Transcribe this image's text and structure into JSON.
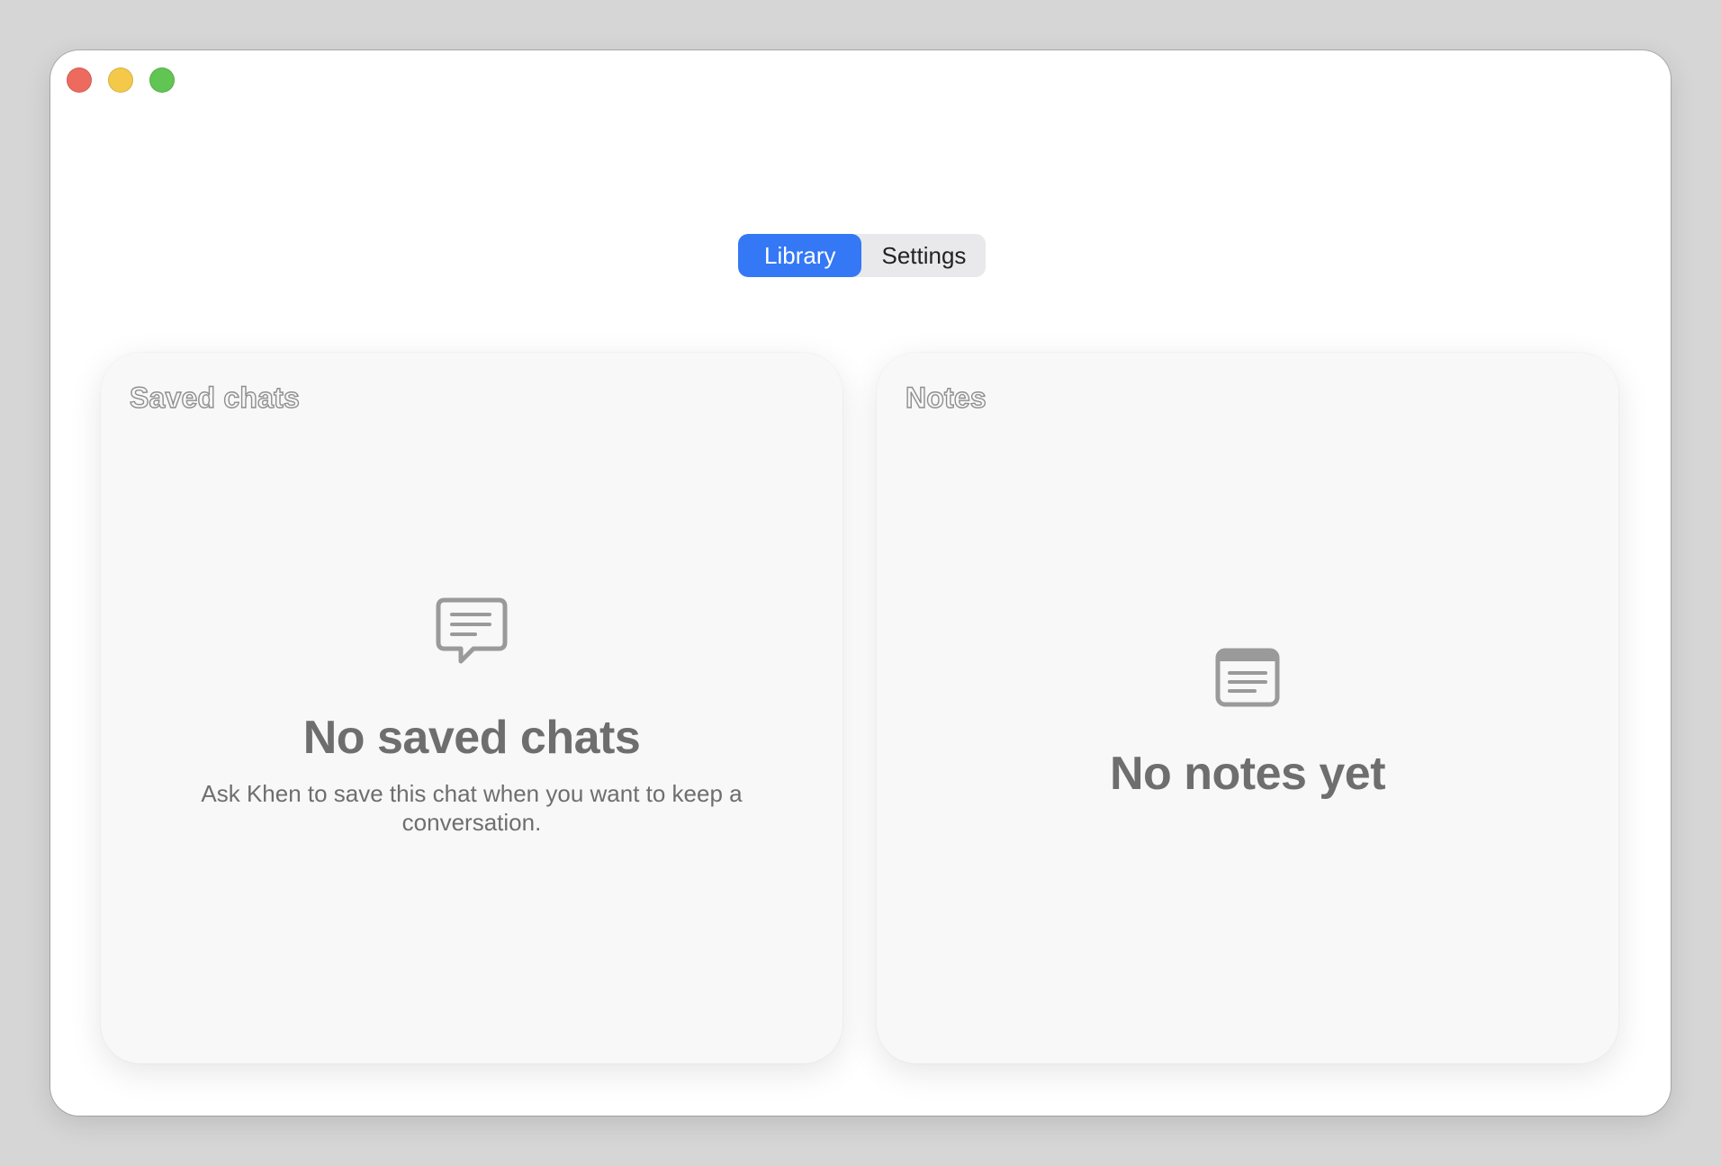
{
  "window": {
    "controls": {
      "close_color": "#ed6a5e",
      "minimize_color": "#f4c94a",
      "zoom_color": "#61c554"
    }
  },
  "tabs": [
    {
      "label": "Library",
      "selected": true
    },
    {
      "label": "Settings",
      "selected": false
    }
  ],
  "accent_color": "#3478f6",
  "saved_chats": {
    "title": "Saved chats",
    "icon": "chat-bubble-icon",
    "empty_title": "No saved chats",
    "empty_description": "Ask Khen to save this chat when you want to keep a conversation."
  },
  "notes": {
    "title": "Notes",
    "icon": "note-document-icon",
    "empty_title": "No notes yet"
  }
}
